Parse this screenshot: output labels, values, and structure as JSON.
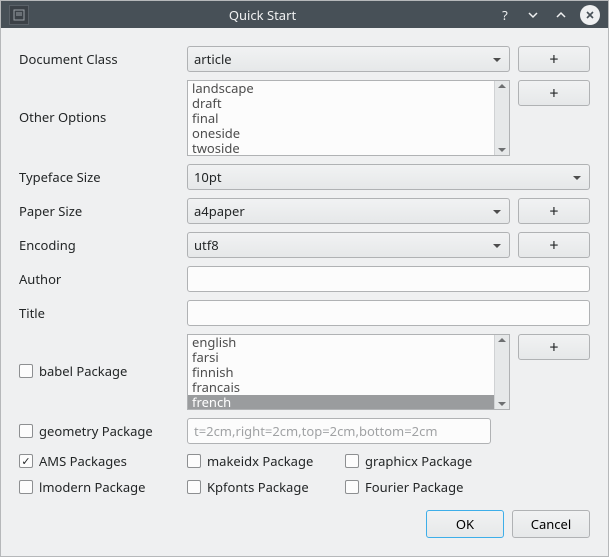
{
  "window": {
    "title": "Quick Start"
  },
  "labels": {
    "document_class": "Document Class",
    "other_options": "Other Options",
    "typeface_size": "Typeface Size",
    "paper_size": "Paper Size",
    "encoding": "Encoding",
    "author": "Author",
    "title": "Title",
    "babel": "babel Package",
    "geometry": "geometry Package",
    "ams": "AMS Packages",
    "lmodern": "lmodern Package",
    "makeidx": "makeidx Package",
    "kpfonts": "Kpfonts Package",
    "graphicx": "graphicx Package",
    "fourier": "Fourier Package"
  },
  "values": {
    "document_class": "article",
    "typeface_size": "10pt",
    "paper_size": "a4paper",
    "encoding": "utf8",
    "author": "",
    "title": "",
    "geometry": "t=2cm,right=2cm,top=2cm,bottom=2cm"
  },
  "other_options": [
    "landscape",
    "draft",
    "final",
    "oneside",
    "twoside"
  ],
  "babel_options": [
    "english",
    "farsi",
    "finnish",
    "francais",
    "french"
  ],
  "babel_selected": "french",
  "checkboxes": {
    "babel": false,
    "geometry": false,
    "ams": true,
    "lmodern": false,
    "makeidx": false,
    "kpfonts": false,
    "graphicx": false,
    "fourier": false
  },
  "buttons": {
    "plus": "+",
    "ok": "OK",
    "cancel": "Cancel"
  }
}
